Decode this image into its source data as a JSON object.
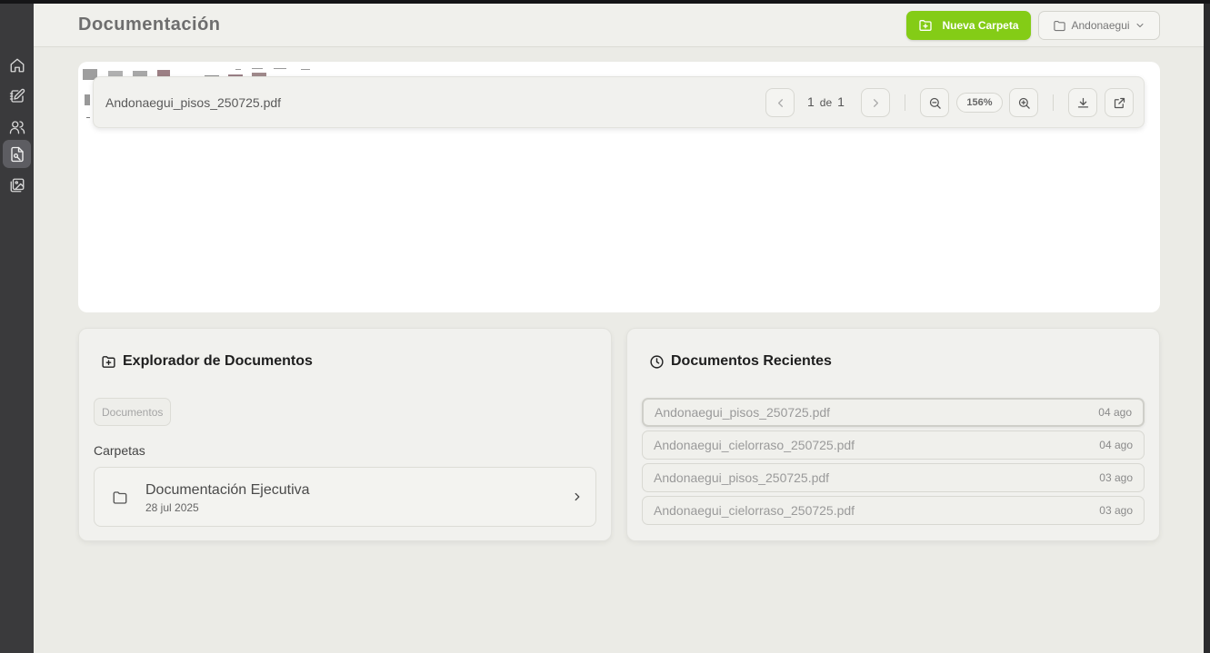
{
  "header": {
    "title": "Documentación",
    "new_folder_label": "Nueva Carpeta",
    "project_label": "Andonaegui"
  },
  "sidebar": {
    "items": [
      {
        "icon": "home-icon"
      },
      {
        "icon": "edit-icon"
      },
      {
        "icon": "users-icon"
      },
      {
        "icon": "document-icon",
        "active": true
      },
      {
        "icon": "gallery-icon"
      }
    ]
  },
  "viewer": {
    "file_name": "Andonaegui_pisos_250725.pdf",
    "page_current": "1",
    "page_of": "de",
    "page_total": "1",
    "zoom": "156%"
  },
  "explorer": {
    "title": "Explorador de Documentos",
    "breadcrumb": "Documentos",
    "folders_label": "Carpetas",
    "folders": [
      {
        "name": "Documentación Ejecutiva",
        "date": "28 jul 2025"
      }
    ]
  },
  "recent": {
    "title": "Documentos Recientes",
    "items": [
      {
        "name": "Andonaegui_pisos_250725.pdf",
        "date": "04 ago"
      },
      {
        "name": "Andonaegui_cielorraso_250725.pdf",
        "date": "04 ago"
      },
      {
        "name": "Andonaegui_pisos_250725.pdf",
        "date": "03 ago"
      },
      {
        "name": "Andonaegui_cielorraso_250725.pdf",
        "date": "03 ago"
      }
    ]
  },
  "colors": {
    "accent": "#84cc16",
    "sidebar": "#3a3a3c",
    "background": "#ebebe6"
  }
}
